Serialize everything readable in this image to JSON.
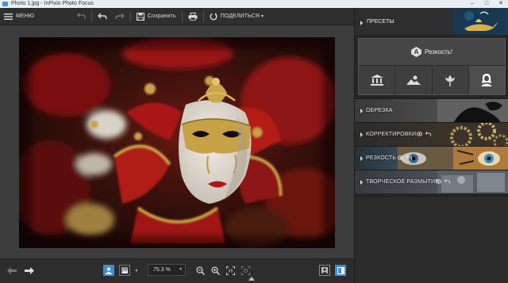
{
  "window": {
    "title": "Photo 1.jpg - InPixio Photo Focus",
    "controls": [
      "–",
      "□",
      "✕"
    ]
  },
  "toolbar": {
    "menu_label": "МЕНЮ",
    "save_label": "Сохранить",
    "share_label": "ПОДЕЛИТЬСЯ",
    "share_caret": "▾"
  },
  "bottombar": {
    "zoom_value": "75.3 %",
    "zoom_caret": "▾"
  },
  "panel": {
    "presets_label": "ПРЕСЕТЫ",
    "sharpness_button": "Резкость!",
    "sharpness_badge": "A",
    "categories": [
      "architecture-icon",
      "landscape-icon",
      "nature-icon",
      "portrait-icon"
    ],
    "sections": [
      {
        "label": "ОБРЕЗКА"
      },
      {
        "label": "КОРРЕКТИРОВКИ"
      },
      {
        "label": "РЕЗКОСТЬ"
      },
      {
        "label": "ТВОРЧЕСКОЕ РАЗМЫТИЕ"
      }
    ]
  },
  "colors": {
    "active_blue": "#3d8fd1",
    "panel_dark": "#262626",
    "toolbar": "#2f2f2f"
  }
}
